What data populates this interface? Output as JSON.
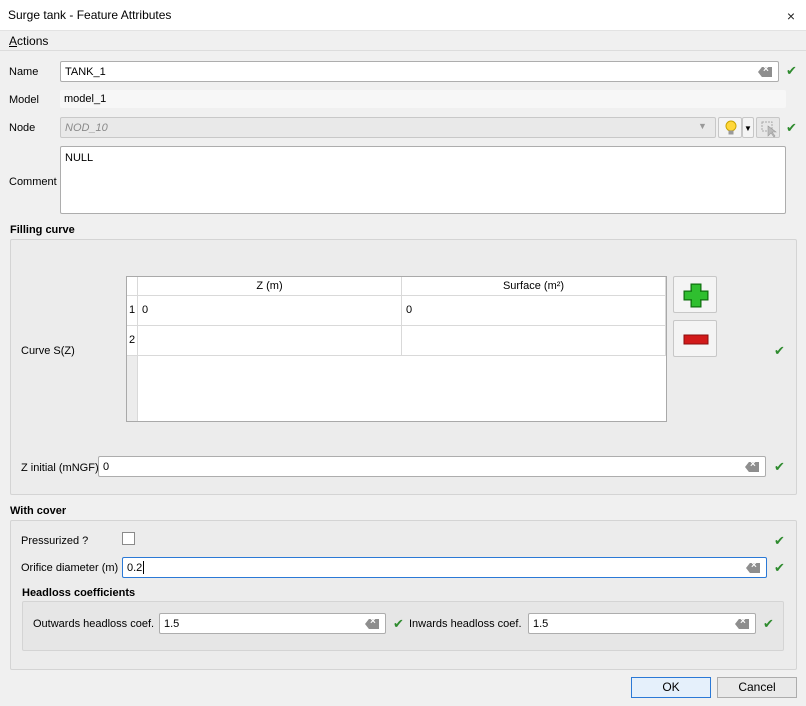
{
  "window": {
    "title": "Surge tank - Feature Attributes",
    "close": "×"
  },
  "menu": {
    "actions_prefix": "A",
    "actions_rest": "ctions"
  },
  "form": {
    "name_label": "Name",
    "name_value": "TANK_1",
    "model_label": "Model",
    "model_value": "model_1",
    "node_label": "Node",
    "node_value": "NOD_10",
    "comment_label": "Comment",
    "comment_value": "NULL"
  },
  "filling_curve": {
    "title": "Filling curve",
    "curve_label": "Curve S(Z)",
    "columns": [
      "Z (m)",
      "Surface (m²)"
    ],
    "rows": [
      {
        "num": "1",
        "z": "0",
        "surface": "0"
      },
      {
        "num": "2",
        "z": "",
        "surface": ""
      }
    ],
    "z_initial_label": "Z initial (mNGF)",
    "z_initial_value": "0"
  },
  "with_cover": {
    "title": "With cover",
    "pressurized_label": "Pressurized ?",
    "pressurized_checked": false,
    "orifice_label": "Orifice diameter (m)",
    "orifice_value": "0.2",
    "headloss": {
      "title": "Headloss coefficients",
      "outwards_label": "Outwards headloss coef.",
      "outwards_value": "1.5",
      "inwards_label": "Inwards headloss coef.",
      "inwards_value": "1.5"
    }
  },
  "buttons": {
    "ok": "OK",
    "cancel": "Cancel"
  },
  "icons": {
    "check": "✔",
    "add": "add-row-icon",
    "remove": "remove-row-icon",
    "bulb": "lightbulb-icon",
    "identify": "identify-feature-icon"
  },
  "colors": {
    "accent": "#2b79d6",
    "valid": "#2e8b2e",
    "add": "#1f9f1f",
    "remove": "#d21a1a"
  }
}
